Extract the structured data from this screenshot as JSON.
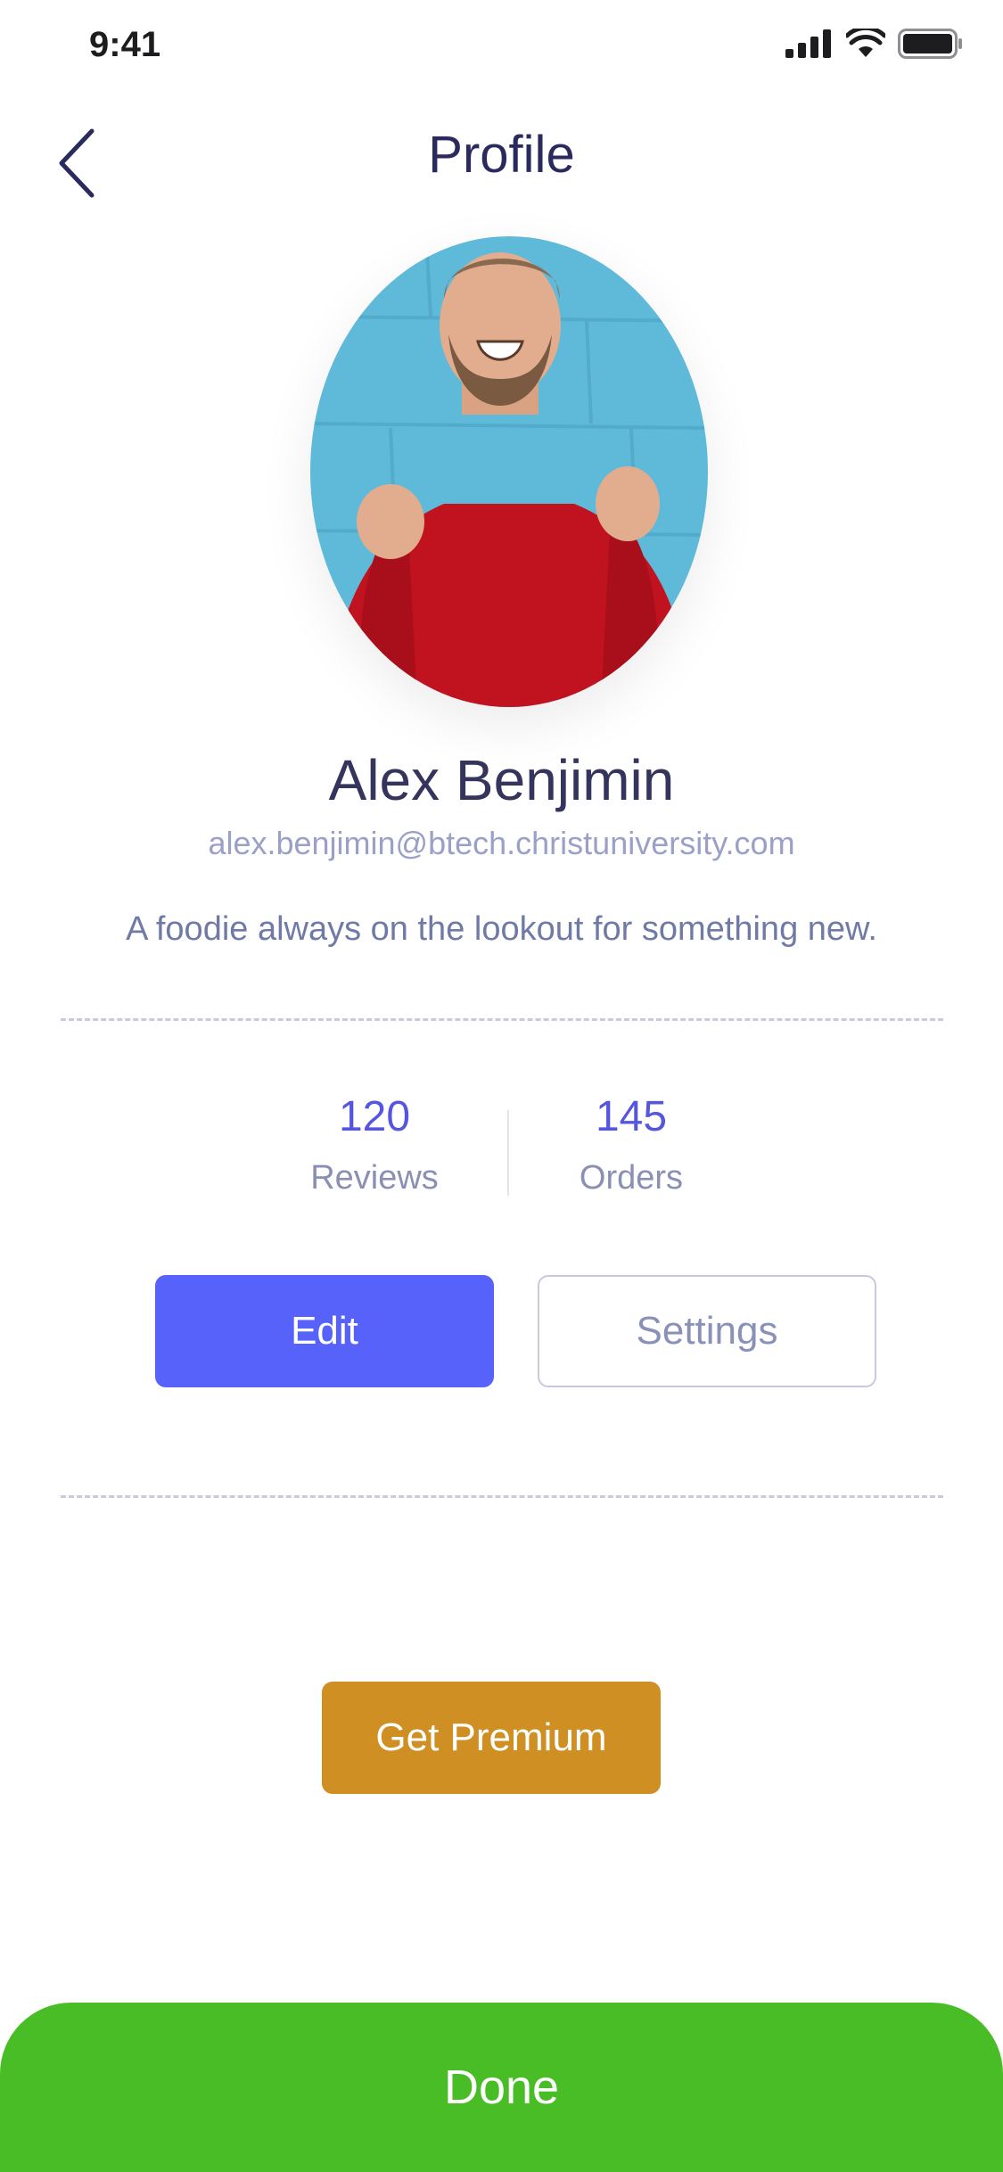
{
  "status_bar": {
    "time": "9:41"
  },
  "header": {
    "title": "Profile"
  },
  "profile": {
    "name": "Alex Benjimin",
    "email": "alex.benjimin@btech.christuniversity.com",
    "bio": "A foodie always on the lookout for something new."
  },
  "stats": [
    {
      "value": "120",
      "label": "Reviews"
    },
    {
      "value": "145",
      "label": "Orders"
    }
  ],
  "actions": {
    "edit_label": "Edit",
    "settings_label": "Settings",
    "premium_label": "Get Premium",
    "done_label": "Done"
  },
  "colors": {
    "accent": "#5762fb",
    "premium": "#cf8f22",
    "done": "#48bd25"
  }
}
